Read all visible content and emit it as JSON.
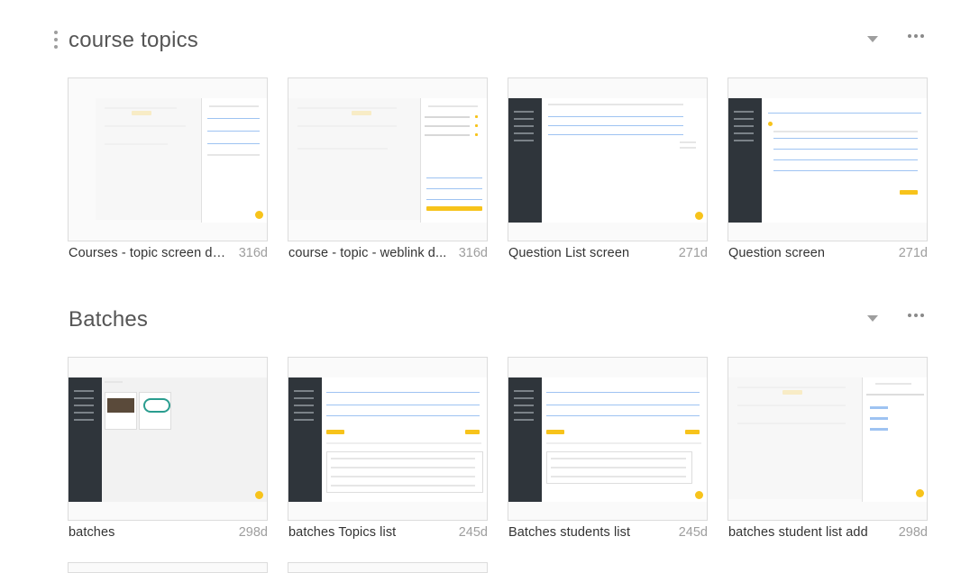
{
  "sections": [
    {
      "title": "course topics",
      "cards": [
        {
          "name": "Courses - topic screen de...",
          "age": "316d"
        },
        {
          "name": "course -  topic - weblink d...",
          "age": "316d"
        },
        {
          "name": "Question List screen",
          "age": "271d"
        },
        {
          "name": "Question screen",
          "age": "271d"
        }
      ]
    },
    {
      "title": "Batches",
      "cards": [
        {
          "name": "batches",
          "age": "298d"
        },
        {
          "name": "batches Topics list",
          "age": "245d"
        },
        {
          "name": "Batches students list",
          "age": "245d"
        },
        {
          "name": "batches student list add",
          "age": "298d"
        }
      ]
    }
  ],
  "icons": {
    "drag_handle": "drag-handle-icon",
    "collapse": "caret-down-icon",
    "more": "more-horizontal-icon"
  },
  "colors": {
    "accent": "#f7c31b",
    "sidebar_dark": "#2f353b",
    "link_blue": "#9ec3f2"
  }
}
